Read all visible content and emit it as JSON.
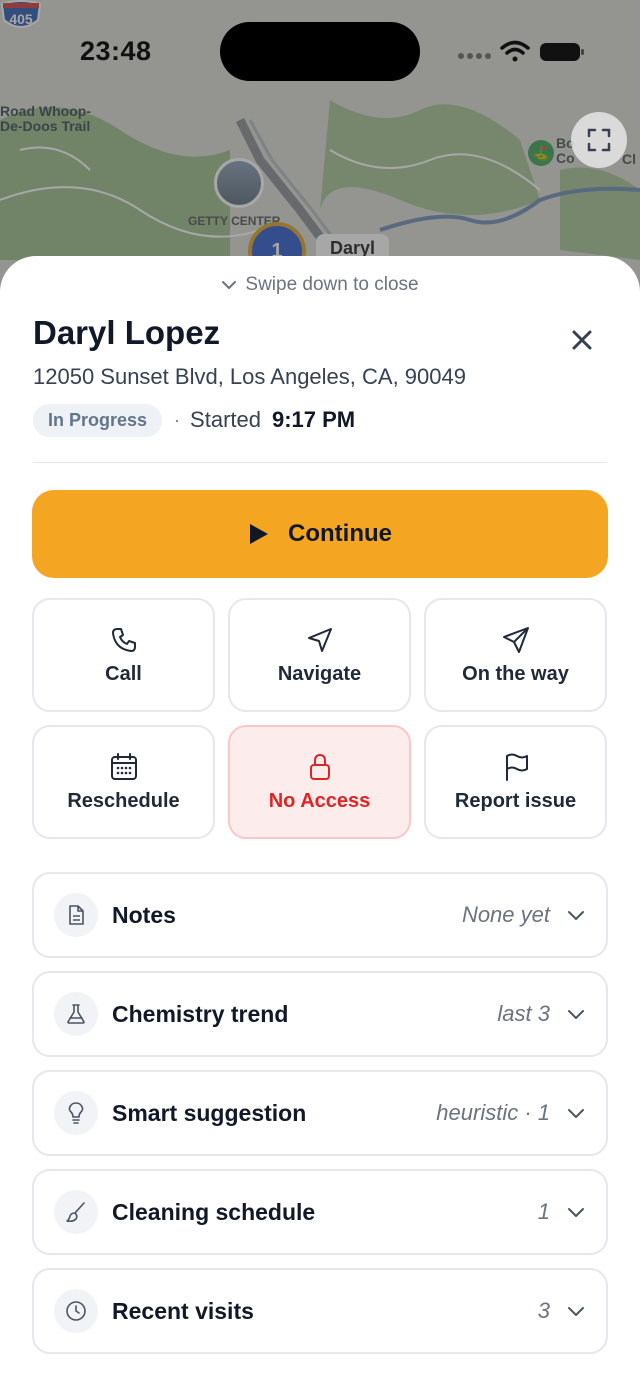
{
  "status_bar": {
    "time": "23:48"
  },
  "map": {
    "labels": [
      "Road Whoop-",
      "De-Doos Trail"
    ],
    "highway": "405",
    "poi_label": "GETTY CENTER",
    "cluster_count": "1",
    "pin_label": "Daryl",
    "right_label": [
      "Bo",
      "Co"
    ],
    "right_label_suffix": "Cl"
  },
  "sheet": {
    "swipe_hint": "Swipe down to close",
    "customer_name": "Daryl Lopez",
    "address": "12050 Sunset Blvd, Los Angeles, CA, 90049",
    "status_badge": "In Progress",
    "separator": "·",
    "started_label": "Started",
    "started_time": "9:17 PM",
    "primary_action": "Continue",
    "actions": [
      {
        "label": "Call",
        "icon": "phone-icon"
      },
      {
        "label": "Navigate",
        "icon": "navigation-arrow-icon"
      },
      {
        "label": "On the way",
        "icon": "send-icon"
      },
      {
        "label": "Reschedule",
        "icon": "calendar-icon"
      },
      {
        "label": "No Access",
        "icon": "lock-icon"
      },
      {
        "label": "Report issue",
        "icon": "flag-icon"
      }
    ],
    "sections": [
      {
        "title": "Notes",
        "meta": "None yet",
        "icon": "document-icon"
      },
      {
        "title": "Chemistry trend",
        "meta": "last 3",
        "icon": "flask-icon"
      },
      {
        "title": "Smart suggestion",
        "meta": "heuristic · 1",
        "icon": "lightbulb-icon"
      },
      {
        "title": "Cleaning schedule",
        "meta": "1",
        "icon": "brush-icon"
      },
      {
        "title": "Recent visits",
        "meta": "3",
        "icon": "clock-icon"
      }
    ]
  },
  "colors": {
    "accent": "#f4a623",
    "danger": "#dc2626",
    "danger_bg": "#fdecec"
  }
}
